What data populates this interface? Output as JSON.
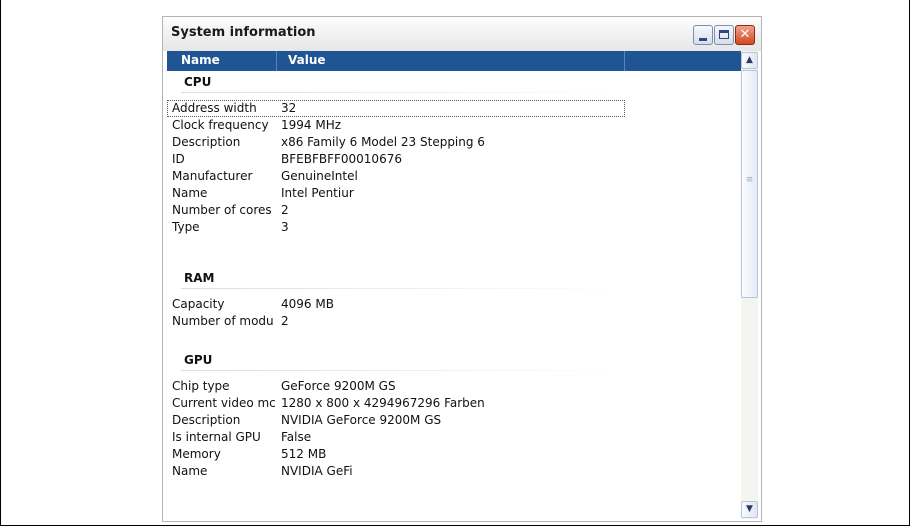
{
  "window": {
    "title": "System information",
    "controls": {
      "minimize": "_",
      "maximize": "□",
      "close": "✕"
    }
  },
  "columns": {
    "name": "Name",
    "value": "Value"
  },
  "groups": [
    {
      "title": "CPU",
      "rows": [
        {
          "name": "Address width",
          "value": "32"
        },
        {
          "name": "Clock frequency",
          "value": "1994 MHz"
        },
        {
          "name": "Description",
          "value": "x86 Family 6 Model 23 Stepping 6"
        },
        {
          "name": "ID",
          "value": "BFEBFBFF00010676"
        },
        {
          "name": "Manufacturer",
          "value": "GenuineIntel"
        },
        {
          "name": "Name",
          "value": "Intel Pentiur"
        },
        {
          "name": "Number of cores",
          "value": "2"
        },
        {
          "name": "Type",
          "value": "3"
        }
      ]
    },
    {
      "title": "RAM",
      "rows": [
        {
          "name": "Capacity",
          "value": "4096 MB"
        },
        {
          "name": "Number of modu",
          "value": "2"
        }
      ]
    },
    {
      "title": "GPU",
      "rows": [
        {
          "name": "Chip type",
          "value": "GeForce 9200M GS"
        },
        {
          "name": "Current video mc",
          "value": "1280 x 800 x 4294967296 Farben"
        },
        {
          "name": "Description",
          "value": "NVIDIA GeForce 9200M GS"
        },
        {
          "name": "Is internal GPU",
          "value": "False"
        },
        {
          "name": "Memory",
          "value": "512 MB"
        },
        {
          "name": "Name",
          "value": "NVIDIA GeFi"
        }
      ]
    }
  ],
  "scrollbar": {
    "up": "▲",
    "down": "▼",
    "grip": "≡"
  }
}
